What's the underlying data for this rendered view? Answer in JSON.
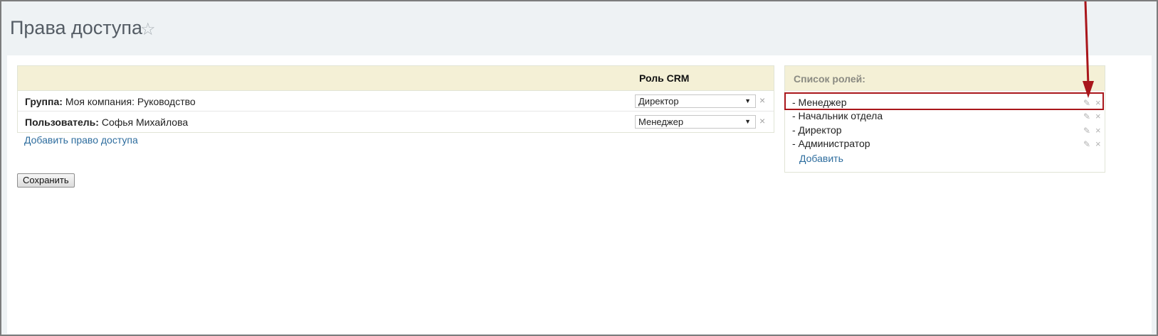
{
  "page": {
    "title": "Права доступа",
    "star_glyph": "☆"
  },
  "rights": {
    "role_column_header": "Роль CRM",
    "rows": [
      {
        "label_bold": "Группа:",
        "label_value": "Моя компания: Руководство",
        "role": "Директор"
      },
      {
        "label_bold": "Пользователь:",
        "label_value": "Софья Михайлова",
        "role": "Менеджер"
      }
    ],
    "add_link": "Добавить право доступа",
    "save_label": "Сохранить"
  },
  "roles_panel": {
    "title": "Список ролей:",
    "items": [
      {
        "label": "- Менеджер"
      },
      {
        "label": "- Начальник отдела"
      },
      {
        "label": "- Директор"
      },
      {
        "label": "- Администратор"
      }
    ],
    "add_link": "Добавить"
  },
  "annotation": {
    "highlight_color": "#a9161b"
  }
}
